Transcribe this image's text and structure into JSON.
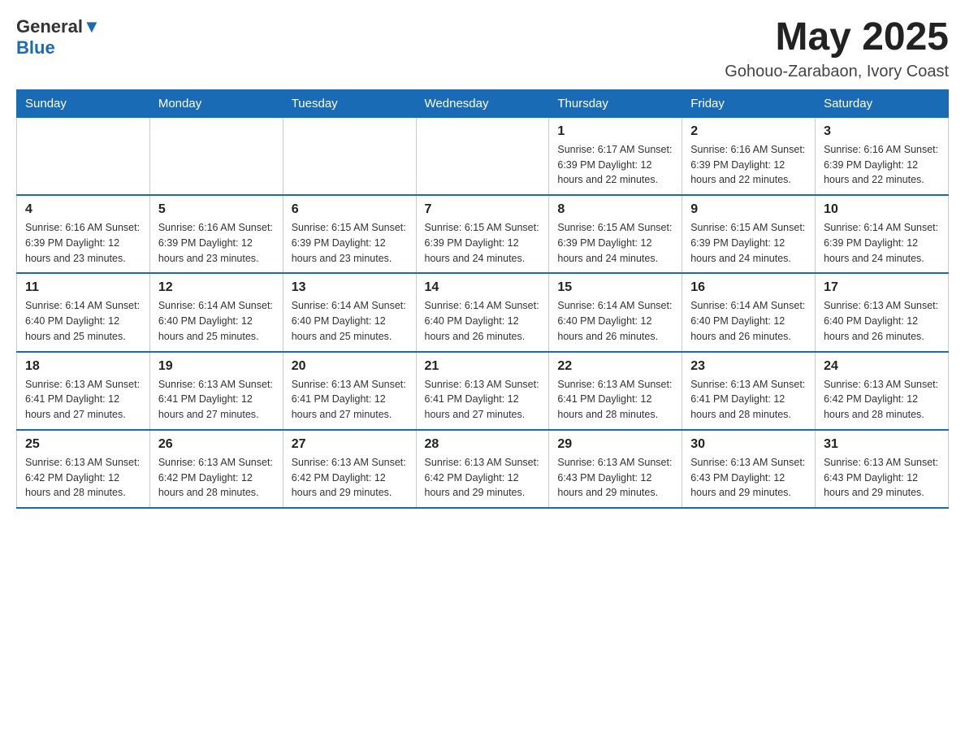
{
  "logo": {
    "text_general": "General",
    "text_blue": "Blue"
  },
  "header": {
    "month_year": "May 2025",
    "location": "Gohouo-Zarabaon, Ivory Coast"
  },
  "days_of_week": [
    "Sunday",
    "Monday",
    "Tuesday",
    "Wednesday",
    "Thursday",
    "Friday",
    "Saturday"
  ],
  "weeks": [
    [
      {
        "day": "",
        "info": ""
      },
      {
        "day": "",
        "info": ""
      },
      {
        "day": "",
        "info": ""
      },
      {
        "day": "",
        "info": ""
      },
      {
        "day": "1",
        "info": "Sunrise: 6:17 AM\nSunset: 6:39 PM\nDaylight: 12 hours and 22 minutes."
      },
      {
        "day": "2",
        "info": "Sunrise: 6:16 AM\nSunset: 6:39 PM\nDaylight: 12 hours and 22 minutes."
      },
      {
        "day": "3",
        "info": "Sunrise: 6:16 AM\nSunset: 6:39 PM\nDaylight: 12 hours and 22 minutes."
      }
    ],
    [
      {
        "day": "4",
        "info": "Sunrise: 6:16 AM\nSunset: 6:39 PM\nDaylight: 12 hours and 23 minutes."
      },
      {
        "day": "5",
        "info": "Sunrise: 6:16 AM\nSunset: 6:39 PM\nDaylight: 12 hours and 23 minutes."
      },
      {
        "day": "6",
        "info": "Sunrise: 6:15 AM\nSunset: 6:39 PM\nDaylight: 12 hours and 23 minutes."
      },
      {
        "day": "7",
        "info": "Sunrise: 6:15 AM\nSunset: 6:39 PM\nDaylight: 12 hours and 24 minutes."
      },
      {
        "day": "8",
        "info": "Sunrise: 6:15 AM\nSunset: 6:39 PM\nDaylight: 12 hours and 24 minutes."
      },
      {
        "day": "9",
        "info": "Sunrise: 6:15 AM\nSunset: 6:39 PM\nDaylight: 12 hours and 24 minutes."
      },
      {
        "day": "10",
        "info": "Sunrise: 6:14 AM\nSunset: 6:39 PM\nDaylight: 12 hours and 24 minutes."
      }
    ],
    [
      {
        "day": "11",
        "info": "Sunrise: 6:14 AM\nSunset: 6:40 PM\nDaylight: 12 hours and 25 minutes."
      },
      {
        "day": "12",
        "info": "Sunrise: 6:14 AM\nSunset: 6:40 PM\nDaylight: 12 hours and 25 minutes."
      },
      {
        "day": "13",
        "info": "Sunrise: 6:14 AM\nSunset: 6:40 PM\nDaylight: 12 hours and 25 minutes."
      },
      {
        "day": "14",
        "info": "Sunrise: 6:14 AM\nSunset: 6:40 PM\nDaylight: 12 hours and 26 minutes."
      },
      {
        "day": "15",
        "info": "Sunrise: 6:14 AM\nSunset: 6:40 PM\nDaylight: 12 hours and 26 minutes."
      },
      {
        "day": "16",
        "info": "Sunrise: 6:14 AM\nSunset: 6:40 PM\nDaylight: 12 hours and 26 minutes."
      },
      {
        "day": "17",
        "info": "Sunrise: 6:13 AM\nSunset: 6:40 PM\nDaylight: 12 hours and 26 minutes."
      }
    ],
    [
      {
        "day": "18",
        "info": "Sunrise: 6:13 AM\nSunset: 6:41 PM\nDaylight: 12 hours and 27 minutes."
      },
      {
        "day": "19",
        "info": "Sunrise: 6:13 AM\nSunset: 6:41 PM\nDaylight: 12 hours and 27 minutes."
      },
      {
        "day": "20",
        "info": "Sunrise: 6:13 AM\nSunset: 6:41 PM\nDaylight: 12 hours and 27 minutes."
      },
      {
        "day": "21",
        "info": "Sunrise: 6:13 AM\nSunset: 6:41 PM\nDaylight: 12 hours and 27 minutes."
      },
      {
        "day": "22",
        "info": "Sunrise: 6:13 AM\nSunset: 6:41 PM\nDaylight: 12 hours and 28 minutes."
      },
      {
        "day": "23",
        "info": "Sunrise: 6:13 AM\nSunset: 6:41 PM\nDaylight: 12 hours and 28 minutes."
      },
      {
        "day": "24",
        "info": "Sunrise: 6:13 AM\nSunset: 6:42 PM\nDaylight: 12 hours and 28 minutes."
      }
    ],
    [
      {
        "day": "25",
        "info": "Sunrise: 6:13 AM\nSunset: 6:42 PM\nDaylight: 12 hours and 28 minutes."
      },
      {
        "day": "26",
        "info": "Sunrise: 6:13 AM\nSunset: 6:42 PM\nDaylight: 12 hours and 28 minutes."
      },
      {
        "day": "27",
        "info": "Sunrise: 6:13 AM\nSunset: 6:42 PM\nDaylight: 12 hours and 29 minutes."
      },
      {
        "day": "28",
        "info": "Sunrise: 6:13 AM\nSunset: 6:42 PM\nDaylight: 12 hours and 29 minutes."
      },
      {
        "day": "29",
        "info": "Sunrise: 6:13 AM\nSunset: 6:43 PM\nDaylight: 12 hours and 29 minutes."
      },
      {
        "day": "30",
        "info": "Sunrise: 6:13 AM\nSunset: 6:43 PM\nDaylight: 12 hours and 29 minutes."
      },
      {
        "day": "31",
        "info": "Sunrise: 6:13 AM\nSunset: 6:43 PM\nDaylight: 12 hours and 29 minutes."
      }
    ]
  ]
}
